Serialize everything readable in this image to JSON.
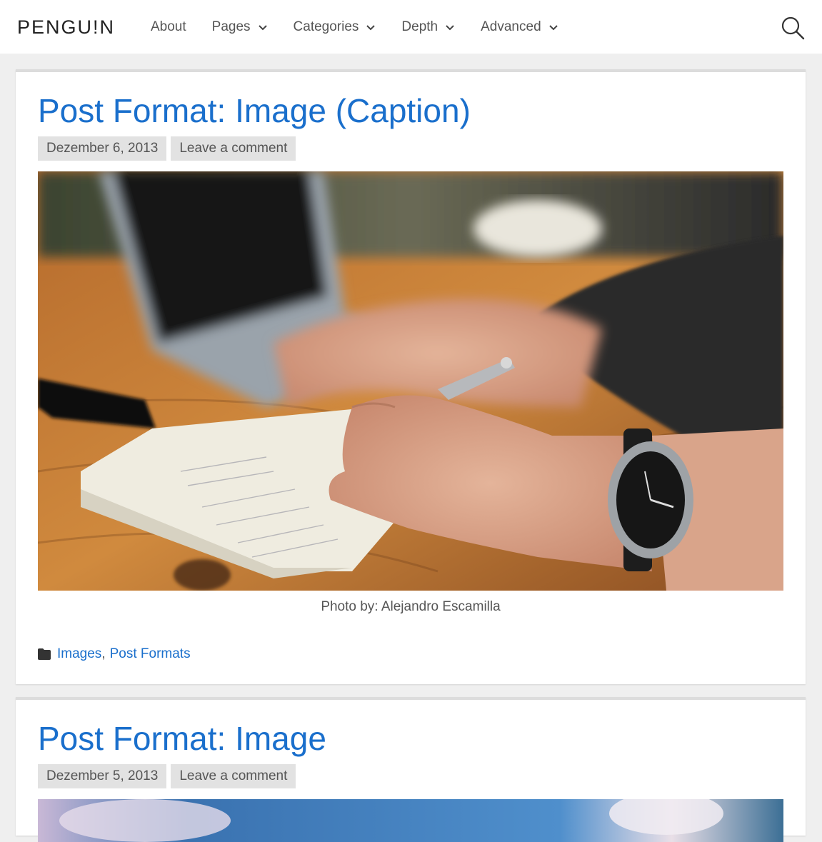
{
  "site": {
    "logo": "PENGU!N"
  },
  "nav": {
    "items": [
      {
        "label": "About",
        "has_dropdown": false
      },
      {
        "label": "Pages",
        "has_dropdown": true
      },
      {
        "label": "Categories",
        "has_dropdown": true
      },
      {
        "label": "Depth",
        "has_dropdown": true
      },
      {
        "label": "Advanced",
        "has_dropdown": true
      }
    ],
    "search_icon": "search-icon"
  },
  "posts": [
    {
      "title": "Post Format: Image (Caption)",
      "date": "Dezember 6, 2013",
      "comment_link": "Leave a comment",
      "caption": "Photo by: Alejandro Escamilla",
      "categories": [
        "Images",
        "Post Formats"
      ],
      "category_icon": "folder-icon"
    },
    {
      "title": "Post Format: Image",
      "date": "Dezember 5, 2013",
      "comment_link": "Leave a comment"
    }
  ],
  "colors": {
    "link": "#1a6fcc",
    "meta_bg": "#e2e2e2",
    "page_bg": "#efefef"
  }
}
